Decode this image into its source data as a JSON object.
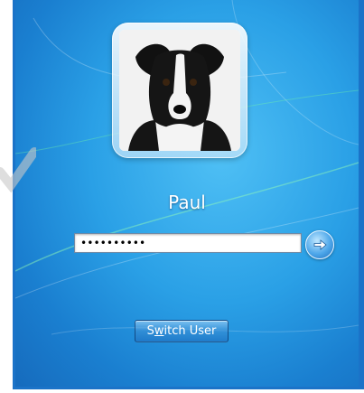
{
  "user": {
    "name": "Paul"
  },
  "login": {
    "password_masked": "••••••••••",
    "submit_icon": "arrow-right-icon"
  },
  "actions": {
    "switch_user_prefix": "S",
    "switch_user_access_key": "w",
    "switch_user_suffix": "itch User"
  },
  "colors": {
    "background": "#2aa0e6",
    "frame": "#1b73c8",
    "text": "#ffffff"
  }
}
